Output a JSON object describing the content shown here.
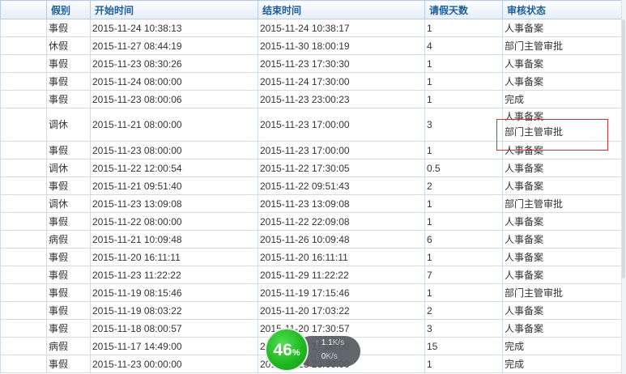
{
  "columns": [
    "",
    "假别",
    "开始时间",
    "结束时间",
    "请假天数",
    "审核状态"
  ],
  "rows": [
    {
      "type": "事假",
      "start": "2015-11-24 10:38:13",
      "end": "2015-11-24 10:38:17",
      "days": "1",
      "status": [
        "人事备案"
      ]
    },
    {
      "type": "休假",
      "start": "2015-11-27 08:44:19",
      "end": "2015-11-30 18:00:19",
      "days": "4",
      "status": [
        "部门主管审批"
      ]
    },
    {
      "type": "事假",
      "start": "2015-11-23 08:30:26",
      "end": "2015-11-23 17:30:30",
      "days": "1",
      "status": [
        "人事备案"
      ]
    },
    {
      "type": "事假",
      "start": "2015-11-24 08:00:00",
      "end": "2015-11-24 17:30:00",
      "days": "1",
      "status": [
        "人事备案"
      ]
    },
    {
      "type": "事假",
      "start": "2015-11-23 08:00:06",
      "end": "2015-11-23 23:00:23",
      "days": "1",
      "status": [
        "完成"
      ]
    },
    {
      "type": "调休",
      "start": "2015-11-21 08:00:00",
      "end": "2015-11-23 17:00:00",
      "days": "3",
      "status": [
        "人事备案",
        "部门主管审批"
      ]
    },
    {
      "type": "事假",
      "start": "2015-11-23 08:00:00",
      "end": "2015-11-23 17:00:00",
      "days": "1",
      "status": [
        "人事备案"
      ]
    },
    {
      "type": "调休",
      "start": "2015-11-22 12:00:54",
      "end": "2015-11-22 17:30:05",
      "days": "0.5",
      "status": [
        "人事备案"
      ]
    },
    {
      "type": "事假",
      "start": "2015-11-21 09:51:40",
      "end": "2015-11-22 09:51:43",
      "days": "2",
      "status": [
        "人事备案"
      ]
    },
    {
      "type": "调休",
      "start": "2015-11-23 13:09:08",
      "end": "2015-11-23 13:09:08",
      "days": "1",
      "status": [
        "部门主管审批"
      ]
    },
    {
      "type": "事假",
      "start": "2015-11-22 08:00:00",
      "end": "2015-11-22 22:09:08",
      "days": "1",
      "status": [
        "人事备案"
      ]
    },
    {
      "type": "病假",
      "start": "2015-11-21 10:09:48",
      "end": "2015-11-26 10:09:48",
      "days": "6",
      "status": [
        "人事备案"
      ]
    },
    {
      "type": "事假",
      "start": "2015-11-20 16:11:11",
      "end": "2015-11-20 16:11:11",
      "days": "1",
      "status": [
        "人事备案"
      ]
    },
    {
      "type": "事假",
      "start": "2015-11-23 11:22:22",
      "end": "2015-11-29 11:22:22",
      "days": "7",
      "status": [
        "人事备案"
      ]
    },
    {
      "type": "事假",
      "start": "2015-11-19 08:15:46",
      "end": "2015-11-19 17:15:46",
      "days": "1",
      "status": [
        "部门主管审批"
      ]
    },
    {
      "type": "事假",
      "start": "2015-11-19 08:03:22",
      "end": "2015-11-20 17:03:22",
      "days": "2",
      "status": [
        "人事备案"
      ]
    },
    {
      "type": "事假",
      "start": "2015-11-18 08:00:57",
      "end": "2015-11-20 17:30:57",
      "days": "3",
      "status": [
        "人事备案"
      ]
    },
    {
      "type": "病假",
      "start": "2015-11-17 14:49:00",
      "end": "2015-11-30 17:00:00",
      "days": "15",
      "status": [
        "完成"
      ]
    },
    {
      "type": "事假",
      "start": "2015-11-23 00:00:00",
      "end": "2015-11-23 23:00:00",
      "days": "1",
      "status": [
        "完成"
      ]
    }
  ],
  "speed_widget": {
    "percent_value": "46",
    "percent_sign": "%",
    "up_value": "1.1",
    "down_value": "0",
    "unit": "K/s",
    "colors": {
      "ball": "#1fb51f",
      "pill": "#555a60",
      "up_arrow": "#f0a030",
      "down_arrow": "#3d8ef0"
    }
  },
  "highlight_color": "#d9312c"
}
